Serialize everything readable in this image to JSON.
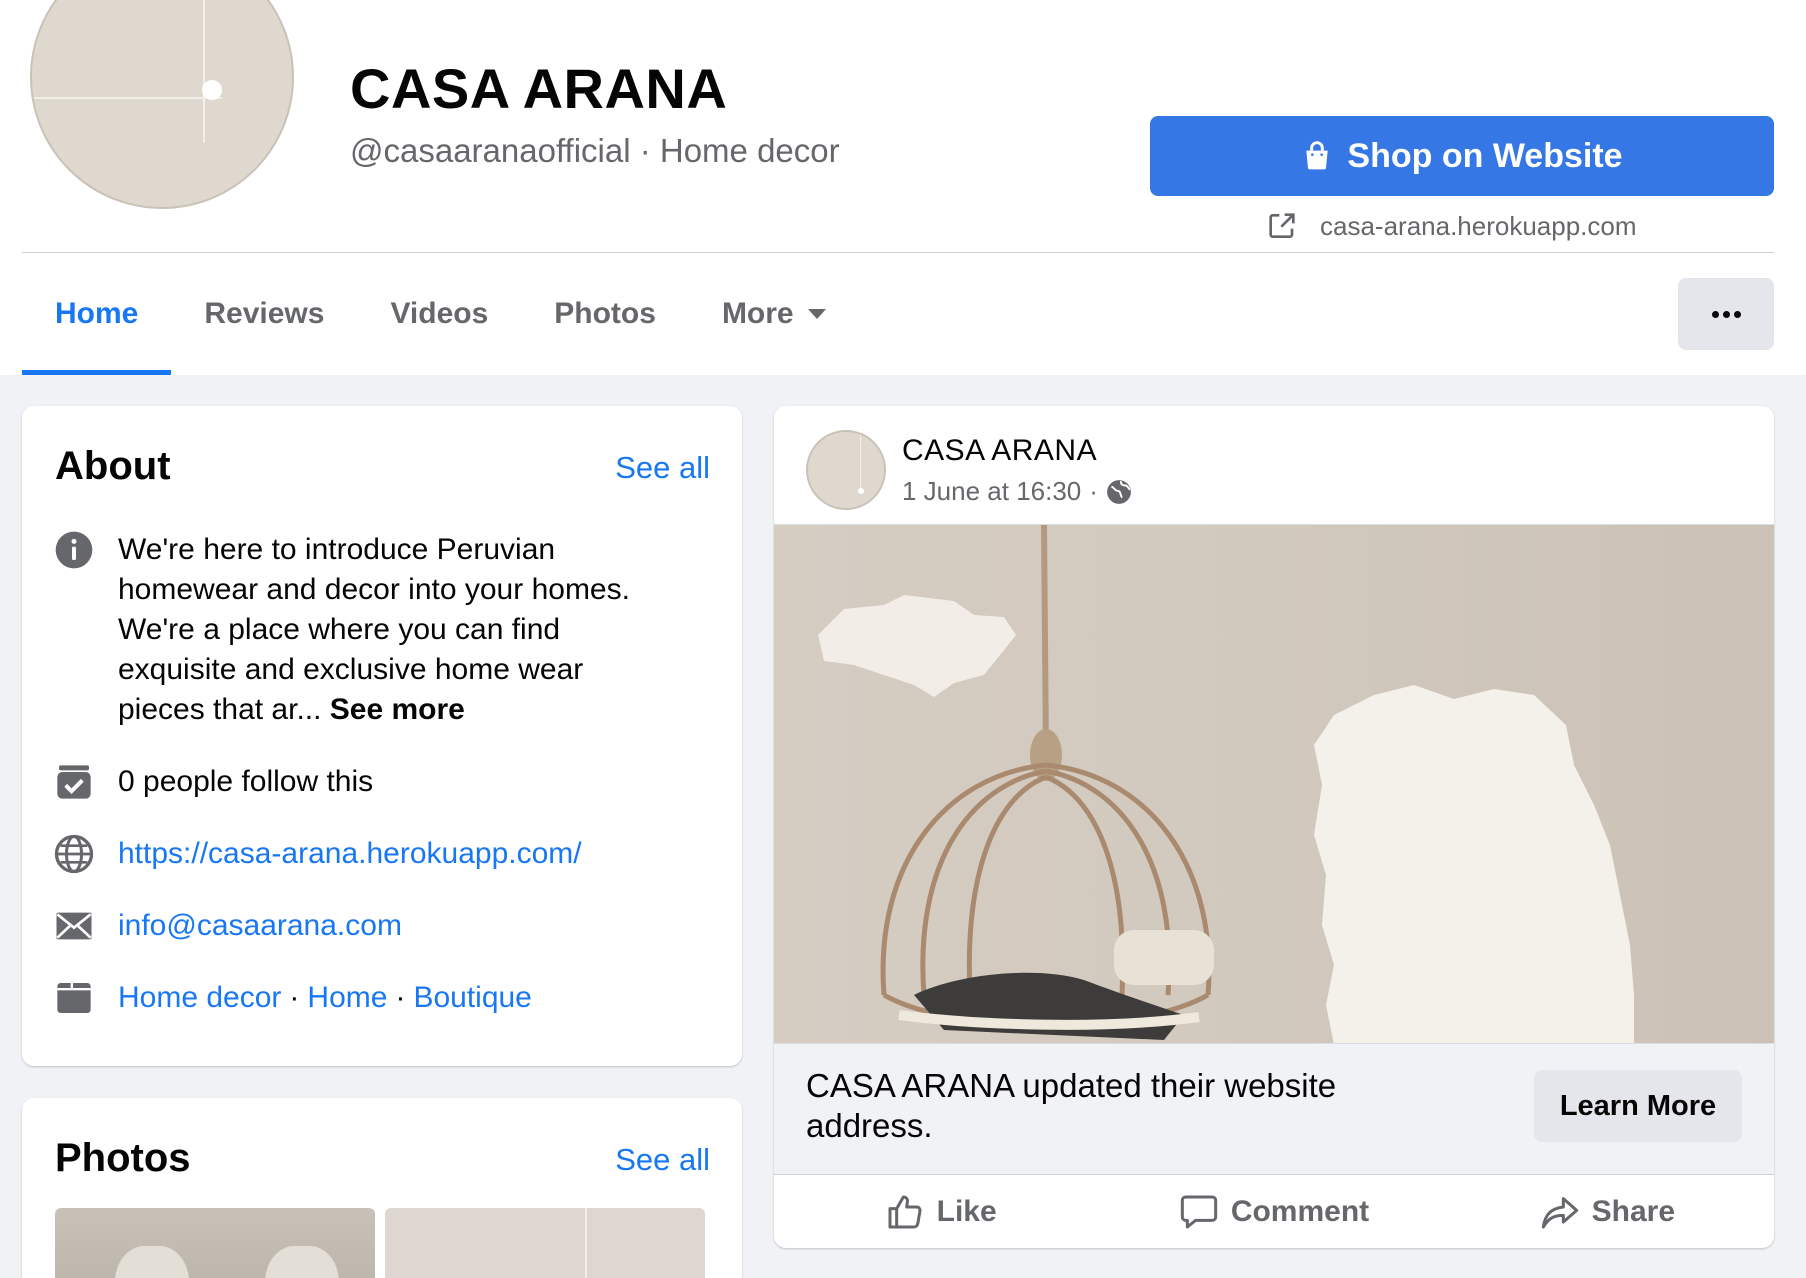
{
  "profile": {
    "name": "CASA ARANA",
    "subtitle": "@casaaranaofficial · Home decor"
  },
  "cta": {
    "shop_label": "Shop on Website",
    "shop_icon": "shopping-bag-icon",
    "website_url": "casa-arana.herokuapp.com",
    "external_icon": "external-link-icon"
  },
  "tabs": [
    {
      "label": "Home",
      "active": true
    },
    {
      "label": "Reviews",
      "active": false
    },
    {
      "label": "Videos",
      "active": false
    },
    {
      "label": "Photos",
      "active": false
    },
    {
      "label": "More",
      "active": false
    }
  ],
  "about": {
    "heading": "About",
    "see_all": "See all",
    "description": "We're here to introduce Peruvian homewear and decor into your homes. We're a place where you can find exquisite and exclusive home wear pieces that ar...",
    "see_more": "See more",
    "followers": "0 people follow this",
    "website": "https://casa-arana.herokuapp.com/",
    "email": "info@casaarana.com",
    "categories": [
      "Home decor",
      "Home",
      "Boutique"
    ]
  },
  "photos": {
    "heading": "Photos",
    "see_all": "See all"
  },
  "post": {
    "author": "CASA ARANA",
    "timestamp": "1 June at 16:30",
    "meta_separator": "·",
    "privacy_icon": "globe-icon",
    "caption": "CASA ARANA updated their website address.",
    "learn_more": "Learn More",
    "actions": {
      "like": "Like",
      "comment": "Comment",
      "share": "Share"
    }
  },
  "colors": {
    "accent": "#1877f2",
    "shop_button": "#3578e5",
    "secondary_text": "#65676b",
    "page_background": "#f0f2f5"
  }
}
